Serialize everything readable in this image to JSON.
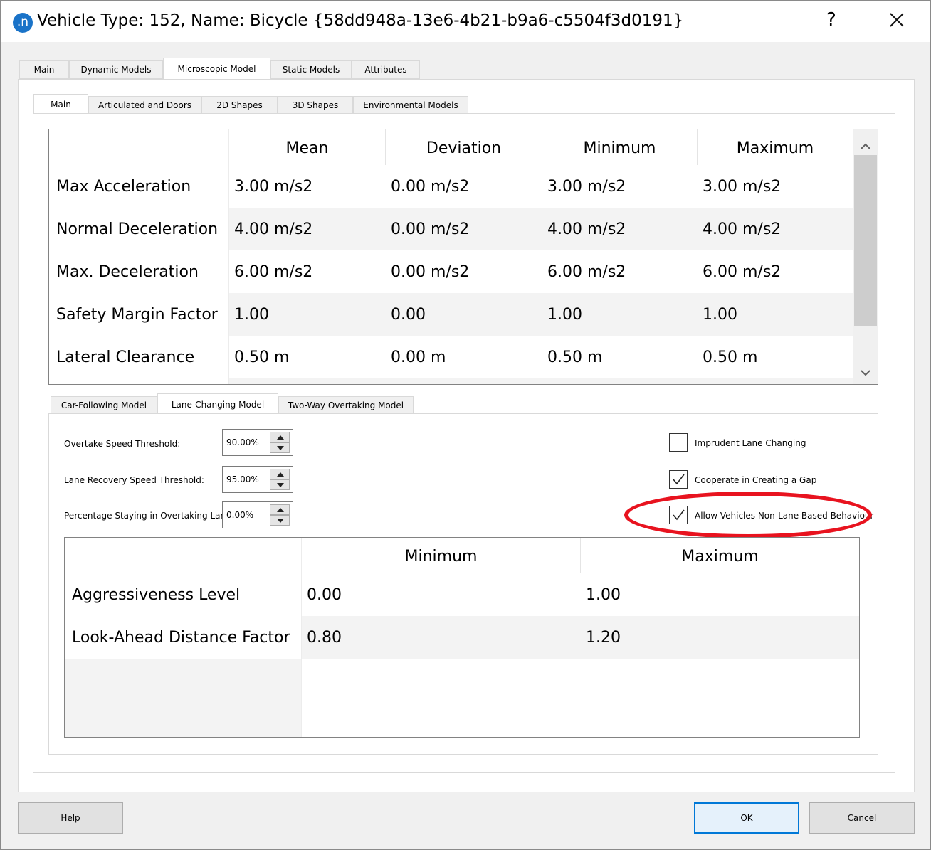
{
  "window": {
    "title": "Vehicle Type: 152, Name: Bicycle  {58dd948a-13e6-4b21-b9a6-c5504f3d0191}",
    "app_icon_glyph": ".n",
    "help_glyph": "?"
  },
  "main_tabs": [
    "Main",
    "Dynamic Models",
    "Microscopic Model",
    "Static Models",
    "Attributes"
  ],
  "main_tab_active": "Microscopic Model",
  "sub_tabs": [
    "Main",
    "Articulated and Doors",
    "2D Shapes",
    "3D Shapes",
    "Environmental Models"
  ],
  "sub_tab_active": "Main",
  "params_grid": {
    "columns": [
      "Mean",
      "Deviation",
      "Minimum",
      "Maximum"
    ],
    "rows": [
      {
        "label": "Max Acceleration",
        "values": [
          "3.00 m/s2",
          "0.00 m/s2",
          "3.00 m/s2",
          "3.00 m/s2"
        ]
      },
      {
        "label": "Normal Deceleration",
        "values": [
          "4.00 m/s2",
          "0.00 m/s2",
          "4.00 m/s2",
          "4.00 m/s2"
        ]
      },
      {
        "label": "Max. Deceleration",
        "values": [
          "6.00 m/s2",
          "0.00 m/s2",
          "6.00 m/s2",
          "6.00 m/s2"
        ]
      },
      {
        "label": "Safety Margin Factor",
        "values": [
          "1.00",
          "0.00",
          "1.00",
          "1.00"
        ]
      },
      {
        "label": "Lateral Clearance",
        "values": [
          "0.50 m",
          "0.00 m",
          "0.50 m",
          "0.50 m"
        ]
      }
    ]
  },
  "model_tabs": [
    "Car-Following Model",
    "Lane-Changing Model",
    "Two-Way Overtaking Model"
  ],
  "model_tab_active": "Lane-Changing Model",
  "lane_changing": {
    "fields": [
      {
        "label": "Overtake Speed Threshold:",
        "value": "90.00%"
      },
      {
        "label": "Lane Recovery Speed Threshold:",
        "value": "95.00%"
      },
      {
        "label": "Percentage Staying in Overtaking Lane:",
        "value": "0.00%"
      }
    ],
    "checkboxes": [
      {
        "label": "Imprudent Lane Changing",
        "checked": false
      },
      {
        "label": "Cooperate in Creating a Gap",
        "checked": true
      },
      {
        "label": "Allow Vehicles Non-Lane Based Behaviour",
        "checked": true
      }
    ],
    "highlight_color": "#e8131f"
  },
  "range_grid": {
    "columns": [
      "Minimum",
      "Maximum"
    ],
    "rows": [
      {
        "label": "Aggressiveness Level",
        "values": [
          "0.00",
          "1.00"
        ]
      },
      {
        "label": "Look-Ahead Distance Factor",
        "values": [
          "0.80",
          "1.20"
        ]
      }
    ]
  },
  "buttons": {
    "help": "Help",
    "ok": "OK",
    "cancel": "Cancel"
  },
  "colors": {
    "accent": "#0078d7",
    "app_icon": "#1a73c8"
  }
}
